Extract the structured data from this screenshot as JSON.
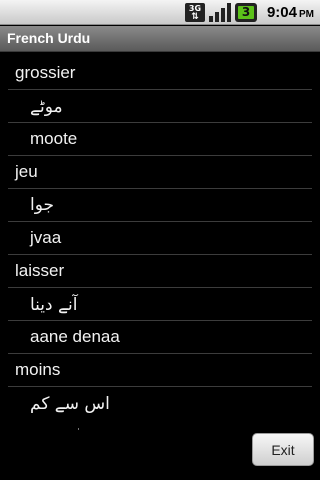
{
  "status_bar": {
    "network_label": "3G",
    "battery_label": "3",
    "time": "9:04",
    "ampm": "PM",
    "battery_color": "#5cc21a",
    "icons": [
      "network-3g-icon",
      "signal-strength-icon",
      "battery-icon"
    ]
  },
  "app": {
    "title": "French Urdu"
  },
  "entries": [
    {
      "word": "grossier",
      "urdu": "موٹے",
      "roman": "moote"
    },
    {
      "word": "jeu",
      "urdu": "جوا",
      "roman": "jvaa"
    },
    {
      "word": "laisser",
      "urdu": "آنے دینا",
      "roman": "aane denaa"
    },
    {
      "word": "moins",
      "urdu": "اس سے کم"
    }
  ],
  "footer": {
    "exit_label": "Exit"
  }
}
